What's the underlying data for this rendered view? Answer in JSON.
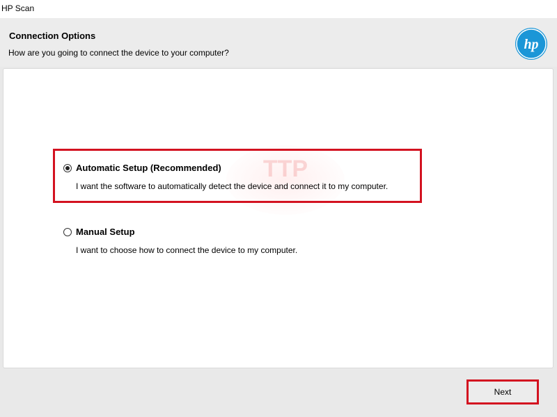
{
  "window": {
    "title": "HP Scan"
  },
  "header": {
    "title": "Connection Options",
    "subtitle": "How are you going to connect the device to your computer?",
    "logo_text": "hp",
    "logo_color": "#1b96d7"
  },
  "options": [
    {
      "label": "Automatic Setup (Recommended)",
      "description": "I want the software to automatically detect the device and connect it to my computer.",
      "selected": true
    },
    {
      "label": "Manual Setup",
      "description": "I want to choose how to connect the device to my computer.",
      "selected": false
    }
  ],
  "watermark": {
    "text": "TTP",
    "color": "#e53935"
  },
  "footer": {
    "next_label": "Next"
  },
  "colors": {
    "highlight": "#d31220",
    "header_bg": "#ececec"
  }
}
